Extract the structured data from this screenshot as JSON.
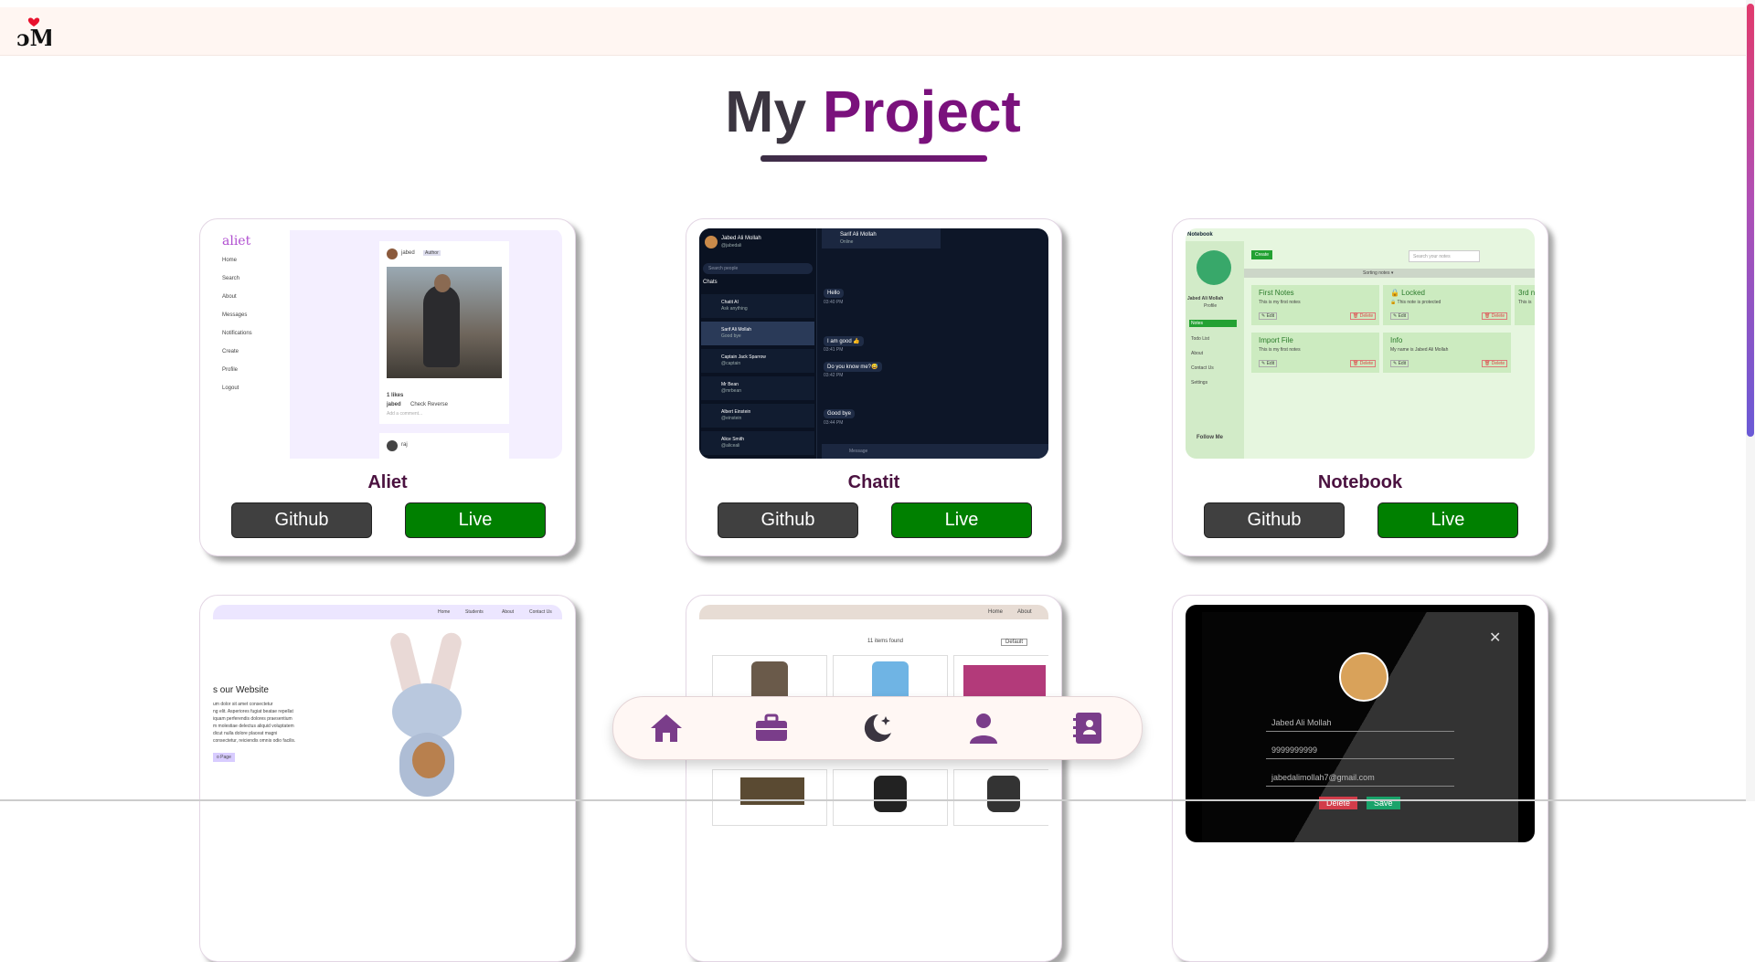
{
  "heading": {
    "word1": "My",
    "word2": "Project"
  },
  "colors": {
    "accent": "#7a117c",
    "live": "#008000",
    "github": "#404040",
    "topbar": "#fff6f2"
  },
  "projects": [
    {
      "title": "Aliet",
      "github": "Github",
      "live": "Live",
      "preview": {
        "brand": "aliet",
        "menu": [
          "Home",
          "Search",
          "About",
          "Messages",
          "Notifications",
          "Create",
          "Profile",
          "Logout"
        ],
        "user": "jabed",
        "badge": "Author",
        "likes": "1 likes",
        "caption_user": "jabed",
        "caption": "Check Reverse",
        "comment": "Add a comment...",
        "user2": "raj"
      }
    },
    {
      "title": "Chatit",
      "github": "Github",
      "live": "Live",
      "preview": {
        "me": "Jabed Ali Mollah",
        "handle": "@jabedali",
        "search": "Search people",
        "chats_label": "Chats",
        "chats": [
          {
            "name": "Chatit AI",
            "sub": "Ask anything"
          },
          {
            "name": "Sarif Ali Mollah",
            "sub": "Good bye"
          },
          {
            "name": "Captain Jack Sparrow",
            "sub": "@captain"
          },
          {
            "name": "Mr Bean",
            "sub": "@mrbean"
          },
          {
            "name": "Albert Einstein",
            "sub": "@einstein"
          },
          {
            "name": "Alice Smith",
            "sub": "@aliceali"
          }
        ],
        "peer": "Sarif Ali Mollah",
        "status": "Online",
        "messages": [
          {
            "text": "Hello",
            "time": "03:40 PM"
          },
          {
            "text": "I am good 👍",
            "time": "03:41 PM"
          },
          {
            "text": "Do you know me?😅",
            "time": "03:42 PM"
          },
          {
            "text": "Good bye",
            "time": "03:44 PM"
          }
        ],
        "input": "Message"
      }
    },
    {
      "title": "Notebook",
      "github": "Github",
      "live": "Live",
      "preview": {
        "brand": "Notebook",
        "create": "Create",
        "search": "Search your notes",
        "sort": "Sorting notes ▾",
        "owner": "Jabed Ali Mollah",
        "profile": "Profile",
        "menu": [
          "Notes",
          "Todo List",
          "About",
          "Contact Us",
          "Settings"
        ],
        "follow": "Follow Me",
        "notes": [
          {
            "title": "First Notes",
            "body": "This is my first notes"
          },
          {
            "title": "🔒 Locked",
            "body": "🔒 This note is protected"
          },
          {
            "title": "3rd n",
            "body": "This is"
          },
          {
            "title": "Import File",
            "body": "This is my first notes"
          },
          {
            "title": "Info",
            "body": "My name is Jabed Ali Mollah"
          }
        ],
        "edit": "✎ Edit",
        "delete": "🗑 Delete"
      }
    },
    {
      "title": "",
      "preview": {
        "nav": [
          "Home",
          "Students",
          "About",
          "Contact Us"
        ],
        "headline": "s our Website",
        "lines": [
          "um dolor sit amet consectetur",
          "ng elit. Asperiores fugiat beatae repellat",
          "iquam perferendis dolores praesentium",
          "m molestiae delectus aliquid voluptatem",
          "dicut nulla dolore placeat magni",
          "consectetur, reiciendis omnis odio facilis."
        ],
        "button": "o Page"
      }
    },
    {
      "title": "",
      "preview": {
        "nav": [
          "Home",
          "About"
        ],
        "count": "11 items found",
        "sort": "Default"
      }
    },
    {
      "title": "",
      "preview": {
        "name": "Jabed Ali Mollah",
        "phone": "9999999999",
        "email": "jabedalimollah7@gmail.com",
        "delete": "Delete",
        "save": "Save",
        "close": "✕"
      }
    }
  ],
  "bottom_nav": [
    "home-icon",
    "briefcase-icon",
    "moon-stars-icon",
    "user-icon",
    "contacts-book-icon"
  ]
}
